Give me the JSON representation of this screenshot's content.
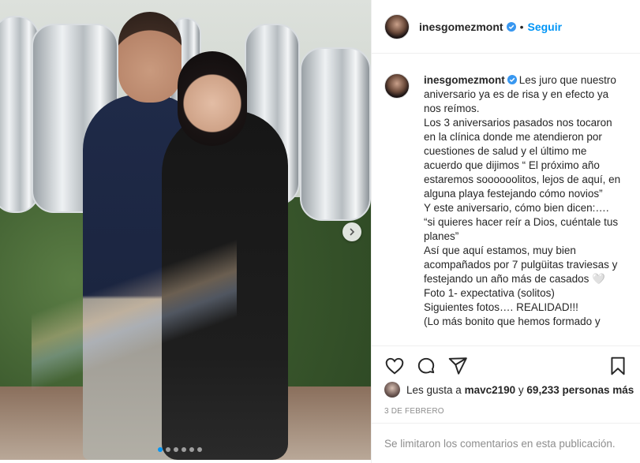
{
  "post": {
    "username": "inesgomezmont",
    "follow_label": "Seguir",
    "separator": "•",
    "caption_lines": [
      "Les juro que nuestro aniversario ya es de risa y en efecto ya nos reímos.",
      "Los 3 aniversarios pasados nos tocaron en la clínica donde me atendieron por cuestiones de salud y el último me acuerdo que dijimos “ El próximo año estaremos soooooolitos, lejos de aquí, en alguna playa festejando cómo novios”",
      "Y este aniversario, cómo bien dicen:…. “si quieres hacer reír a Dios, cuéntale tus planes”",
      "Así que aquí estamos, muy bien acompañados por 7 pulgüitas traviesas y festejando un año más de casados 🤍",
      "Foto 1- expectativa (solitos)",
      "Siguientes fotos…. REALIDAD!!!",
      "(Lo más bonito que hemos formado y"
    ],
    "likes_prefix": "Les gusta a",
    "likes_user": "mavc2190",
    "likes_connector": "y",
    "likes_count": "69,233 personas más",
    "date": "3 DE FEBRERO",
    "comments_disabled": "Se limitaron los comentarios en esta publicación."
  },
  "icons": {
    "verified": "verified-badge-icon",
    "like": "heart-icon",
    "comment": "comment-bubble-icon",
    "share": "paper-plane-icon",
    "save": "bookmark-icon",
    "next": "chevron-right-icon"
  },
  "carousel": {
    "total_slides": 6,
    "active_index": 0
  },
  "colors": {
    "accent": "#0095f6",
    "text": "#262626",
    "muted": "#8e8e8e"
  }
}
